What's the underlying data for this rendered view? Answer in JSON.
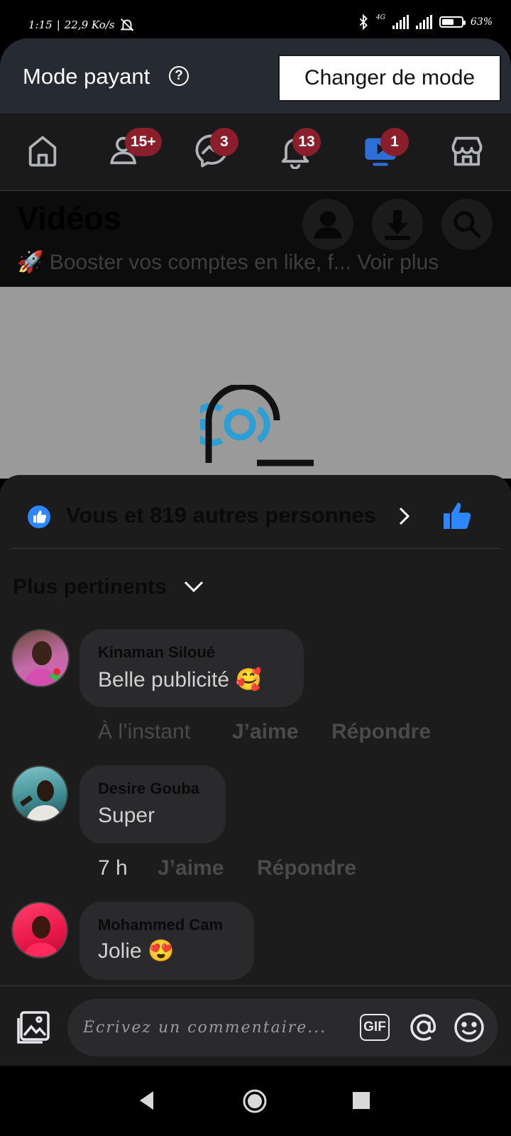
{
  "status_bar": {
    "time": "1:15",
    "net_speed": "22,9 Ko/s",
    "net_type": "4G",
    "battery": "63%",
    "battery_level": 0.63
  },
  "mode_banner": {
    "label": "Mode payant",
    "help_glyph": "?",
    "change_button": "Changer de mode"
  },
  "nav": {
    "items": [
      {
        "icon": "home-icon"
      },
      {
        "icon": "friends-icon",
        "badge": "15+"
      },
      {
        "icon": "messenger-icon",
        "badge": "3"
      },
      {
        "icon": "bell-icon",
        "badge": "13"
      },
      {
        "icon": "video-icon",
        "badge": "1",
        "active": true
      },
      {
        "icon": "marketplace-icon"
      }
    ]
  },
  "videos": {
    "title": "Vidéos",
    "post_text": "🚀 Booster vos comptes en like, f... Voir plus"
  },
  "sheet": {
    "likes_text": "Vous et 819 autres personnes",
    "sort_label": "Plus pertinents",
    "comments": [
      {
        "name": "Kinaman Siloué",
        "text": "Belle publicité 🥰",
        "time": "À l’instant",
        "like": "J’aime",
        "reply": "Répondre"
      },
      {
        "name": "Desire Gouba",
        "text": "Super",
        "time": "7 h",
        "like": "J’aime",
        "reply": "Répondre"
      },
      {
        "name": "Mohammed Cam",
        "text": "Jolie 😍"
      }
    ]
  },
  "composer": {
    "placeholder": "Écrivez un commentaire...",
    "gif_label": "GIF"
  },
  "colors": {
    "accent_blue": "#2d88ff",
    "badge_red": "#8a1e2b",
    "sheet_bg": "#1c1c1d"
  }
}
